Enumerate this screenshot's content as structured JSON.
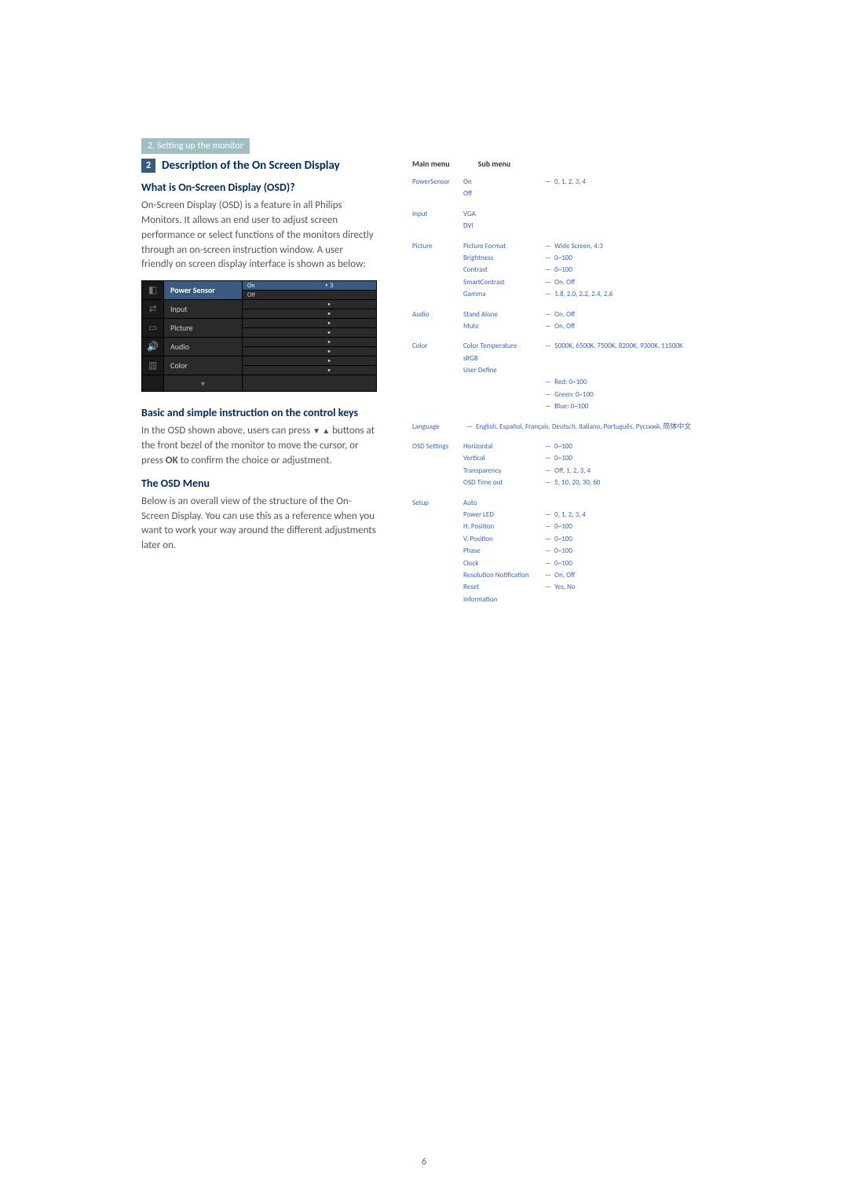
{
  "breadcrumb": "2. Setting up the monitor",
  "section": {
    "number": "2",
    "title": "Description of the On Screen Display"
  },
  "h_what": "What is On-Screen Display (OSD)?",
  "p_what": "On-Screen Display (OSD) is a feature in all Philips Monitors. It allows an end user to adjust screen performance or select functions of the monitors directly through an on-screen instruction window. A user friendly on screen display interface is shown as below:",
  "osd": {
    "rows": [
      {
        "icon": "◧",
        "label": "Power Sensor",
        "active": true,
        "mid": [
          "On",
          "Off"
        ],
        "midHL": 0,
        "right": [
          "‣    3",
          ""
        ],
        "rightHL": 0
      },
      {
        "icon": "⇄",
        "label": "Input",
        "mid": [
          "",
          ""
        ],
        "right": [
          "•",
          "•"
        ]
      },
      {
        "icon": "▭",
        "label": "Picture",
        "mid": [
          "",
          ""
        ],
        "right": [
          "•",
          "•"
        ]
      },
      {
        "icon": "🔊",
        "label": "Audio",
        "mid": [
          "",
          ""
        ],
        "right": [
          "•",
          "•"
        ]
      },
      {
        "icon": "▥",
        "label": "Color",
        "mid": [
          "",
          ""
        ],
        "right": [
          "•",
          "•"
        ]
      }
    ],
    "arrow": "▾"
  },
  "h_basic": "Basic and simple instruction on the control keys",
  "p_basic_1": "In the OSD shown above, users can press ",
  "arrows_text": "▼ ▲",
  "p_basic_2": " buttons at the front bezel of the monitor to move the cursor, or press ",
  "ok_text": "OK",
  "p_basic_3": " to confirm the choice or adjustment.",
  "h_menu": "The OSD Menu",
  "p_menu": "Below is an overall view of the structure of the On-Screen Display. You can use this as a reference when you want to work your way around the different adjustments later on.",
  "head_main": "Main menu",
  "head_sub": "Sub menu",
  "tree": [
    {
      "label": "PowerSensor",
      "subs": [
        {
          "label": "On",
          "vals": "0, 1, 2, 3, 4"
        },
        {
          "label": "Off"
        }
      ]
    },
    {
      "label": "Input",
      "subs": [
        {
          "label": "VGA"
        },
        {
          "label": "DVI"
        }
      ]
    },
    {
      "label": "Picture",
      "subs": [
        {
          "label": "Picture Format",
          "vals": "Wide Screen, 4:3"
        },
        {
          "label": "Brightness",
          "vals": "0~100"
        },
        {
          "label": "Contrast",
          "vals": "0~100"
        },
        {
          "label": "SmartContrast",
          "vals": "On, Off"
        },
        {
          "label": "Gamma",
          "vals": "1.8, 2.0, 2.2, 2.4, 2.6"
        }
      ]
    },
    {
      "label": "Audio",
      "subs": [
        {
          "label": "Stand Alone",
          "vals": "On, Off"
        },
        {
          "label": "Mute",
          "vals": "On, Off"
        }
      ]
    },
    {
      "label": "Color",
      "subs": [
        {
          "label": "Color Temperature",
          "vals": "5000K, 6500K, 7500K, 8200K, 9300K, 11500K"
        },
        {
          "label": "sRGB"
        },
        {
          "label": "User Define",
          "subs2": [
            "Red: 0~100",
            "Green: 0~100",
            "Blue: 0~100"
          ]
        }
      ]
    },
    {
      "label": "Language",
      "text": "English, Español, Français, Deutsch, Italiano, Português, Русский, 简体中文"
    },
    {
      "label": "OSD Settings",
      "subs": [
        {
          "label": "Horizontal",
          "vals": "0~100"
        },
        {
          "label": "Vertical",
          "vals": "0~100"
        },
        {
          "label": "Transparency",
          "vals": "Off, 1, 2, 3, 4"
        },
        {
          "label": "OSD Time out",
          "vals": "5, 10, 20, 30, 60"
        }
      ]
    },
    {
      "label": "Setup",
      "subs": [
        {
          "label": "Auto"
        },
        {
          "label": "Power LED",
          "vals": "0, 1, 2, 3, 4"
        },
        {
          "label": "H. Position",
          "vals": "0~100"
        },
        {
          "label": "V. Position",
          "vals": "0~100"
        },
        {
          "label": "Phase",
          "vals": "0~100"
        },
        {
          "label": "Clock",
          "vals": "0~100"
        },
        {
          "label": "Resolution Notification",
          "vals": "On, Off"
        },
        {
          "label": "Reset",
          "vals": "Yes, No"
        },
        {
          "label": "Information"
        }
      ]
    }
  ],
  "page_number": "6"
}
